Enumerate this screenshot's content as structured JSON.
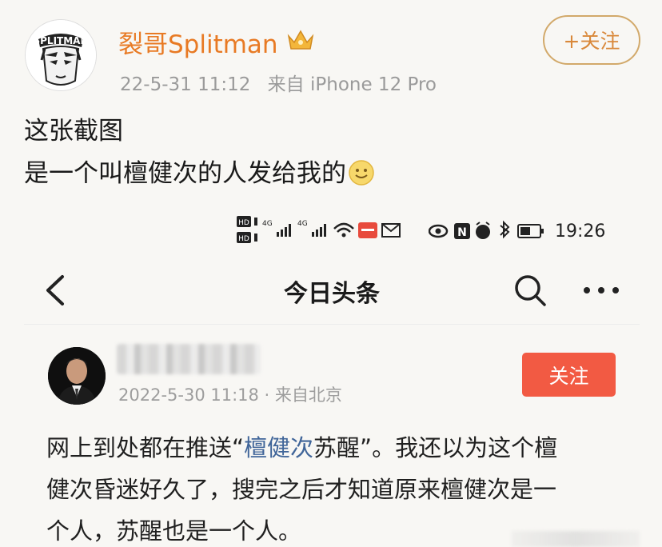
{
  "weibo_post": {
    "author_name": "裂哥Splitman",
    "avatar_text": "SPLITMAN",
    "timestamp": "22-5-31 11:12",
    "source": "来自 iPhone 12 Pro",
    "follow_label": "+关注",
    "text_line_1": "这张截图",
    "text_line_2": "是一个叫檀健次的人发给我的"
  },
  "phone_screenshot": {
    "status_bar": {
      "left_labels": [
        "HD",
        "HD",
        "4G",
        "4G"
      ],
      "time": "19:26"
    },
    "app_bar": {
      "title": "今日头条"
    },
    "post": {
      "meta": "2022-5-30 11:18 · 来自北京",
      "follow_label": "关注",
      "line_1_prefix": "网上到处都在推送“",
      "line_1_link": "檀健次",
      "line_1_suffix": "苏醒”。我还以为这个檀",
      "line_2": "健次昏迷好久了，搜完之后才知道原来檀健次是一",
      "line_3": "个人，苏醒也是一个人。"
    }
  },
  "colors": {
    "author_orange": "#e87a24",
    "follow_red": "#f25a43",
    "link_blue": "#406599"
  }
}
